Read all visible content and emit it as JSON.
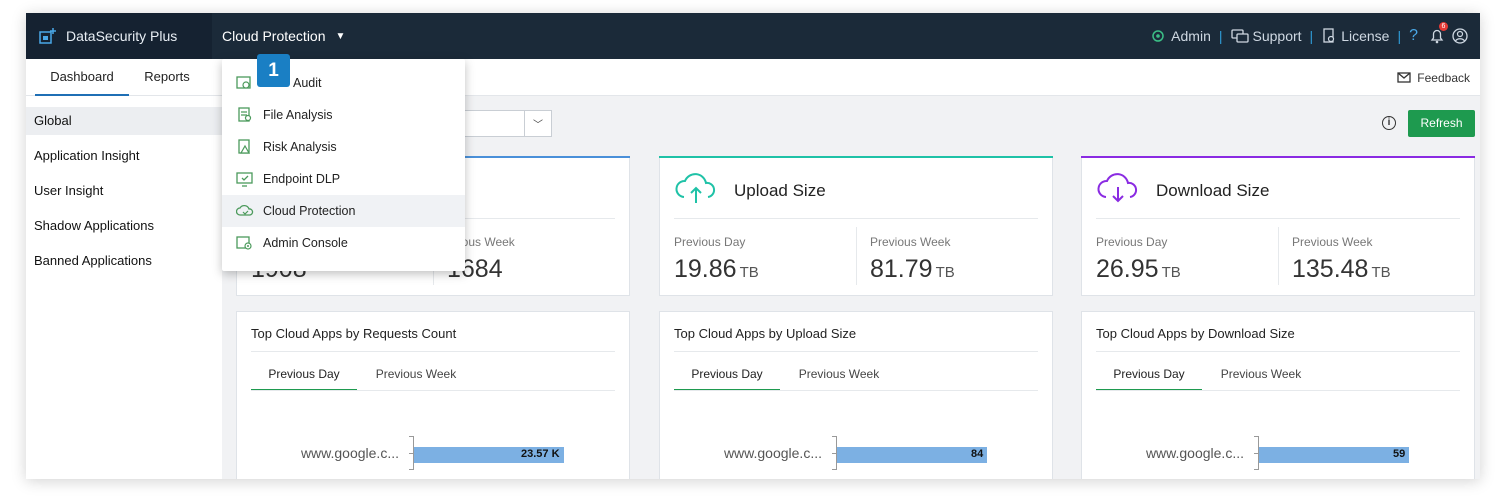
{
  "header": {
    "brand": "DataSecurity Plus",
    "module": "Cloud Protection",
    "links": {
      "admin": "Admin",
      "support": "Support",
      "license": "License",
      "help": "?",
      "notif_count": "6"
    }
  },
  "tabs": {
    "dashboard": "Dashboard",
    "reports": "Reports",
    "feedback": "Feedback"
  },
  "sidebar": {
    "items": [
      {
        "label": "Global"
      },
      {
        "label": "Application Insight"
      },
      {
        "label": "User Insight"
      },
      {
        "label": "Shadow Applications"
      },
      {
        "label": "Banned Applications"
      }
    ]
  },
  "toolbar": {
    "refresh": "Refresh",
    "info": "i"
  },
  "dropdown": {
    "items": [
      {
        "label": "Audit"
      },
      {
        "label": "File Analysis"
      },
      {
        "label": "Risk Analysis"
      },
      {
        "label": "Endpoint DLP"
      },
      {
        "label": "Cloud Protection"
      },
      {
        "label": "Admin Console"
      }
    ],
    "step_badge": "1"
  },
  "stats": {
    "requests": {
      "title_fragment": "d",
      "week_label_fragment": "vious Week",
      "day_value_fragment": "1908",
      "week_value_fragment": "1684"
    },
    "upload": {
      "title": "Upload Size",
      "day_label": "Previous Day",
      "day_value": "19.86",
      "day_unit": "TB",
      "week_label": "Previous Week",
      "week_value": "81.79",
      "week_unit": "TB"
    },
    "download": {
      "title": "Download Size",
      "day_label": "Previous Day",
      "day_value": "26.95",
      "day_unit": "TB",
      "week_label": "Previous Week",
      "week_value": "135.48",
      "week_unit": "TB"
    }
  },
  "colors": {
    "requests_accent": "#4a90d9",
    "upload_accent": "#1fc2a7",
    "download_accent": "#8a2be2",
    "refresh_green": "#1e9a4f"
  },
  "charts": {
    "requests": {
      "title": "Top Cloud Apps by Requests Count",
      "tab_day": "Previous Day",
      "tab_week": "Previous Week"
    },
    "upload": {
      "title": "Top Cloud Apps by Upload Size",
      "tab_day": "Previous Day",
      "tab_week": "Previous Week"
    },
    "download": {
      "title": "Top Cloud Apps by Download Size",
      "tab_day": "Previous Day",
      "tab_week": "Previous Week"
    }
  },
  "chart_data": [
    {
      "type": "bar",
      "title": "Top Cloud Apps by Requests Count",
      "categories": [
        "www.google.c..."
      ],
      "values": [
        23570
      ],
      "value_labels": [
        "23.57 K"
      ]
    },
    {
      "type": "bar",
      "title": "Top Cloud Apps by Upload Size",
      "categories": [
        "www.google.c..."
      ],
      "values": [
        84
      ],
      "value_labels": [
        "84"
      ]
    },
    {
      "type": "bar",
      "title": "Top Cloud Apps by Download Size",
      "categories": [
        "www.google.c..."
      ],
      "values": [
        59
      ],
      "value_labels": [
        "59"
      ]
    }
  ]
}
